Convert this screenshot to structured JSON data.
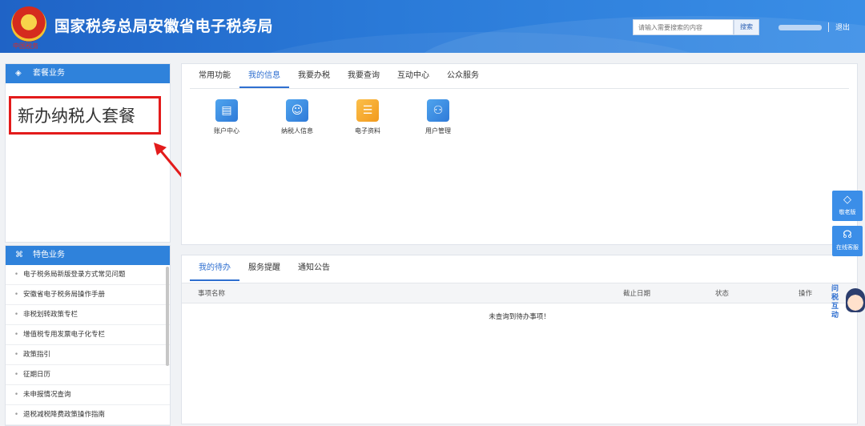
{
  "header": {
    "title": "国家税务总局安徽省电子税务局",
    "emblem_caption": "中国税务",
    "search_placeholder": "请输入需要搜索的内容",
    "search_button": "搜索",
    "logout": "退出"
  },
  "left_panel_package": {
    "title": "套餐业务",
    "highlight_item": "新办纳税人套餐"
  },
  "left_panel_featured": {
    "title": "特色业务",
    "items": [
      "电子税务局新版登录方式常见问题",
      "安徽省电子税务局操作手册",
      "非税划转政策专栏",
      "增值税专用发票电子化专栏",
      "政策指引",
      "征期日历",
      "未申报情况查询",
      "退税减税降费政策操作指南"
    ]
  },
  "main_tabs": [
    "常用功能",
    "我的信息",
    "我要办税",
    "我要查询",
    "互动中心",
    "公众服务"
  ],
  "main_active_tab_index": 1,
  "functions": [
    {
      "label": "账户中心",
      "icon": "account-icon"
    },
    {
      "label": "纳税人信息",
      "icon": "taxpayer-card-icon"
    },
    {
      "label": "电子资料",
      "icon": "documents-icon"
    },
    {
      "label": "用户管理",
      "icon": "users-icon"
    }
  ],
  "todo_panel": {
    "tabs": [
      "我的待办",
      "服务提醒",
      "通知公告"
    ],
    "active_tab_index": 0,
    "columns": [
      "事项名称",
      "截止日期",
      "状态",
      "操作"
    ],
    "empty_message": "未查询到待办事项！"
  },
  "floating": {
    "elder_mode": "敬老版",
    "online_service": "在线客服",
    "assistant_text": "问税互动"
  },
  "colors": {
    "header_blue": "#1f63c6",
    "panel_head_blue": "#2f82db",
    "active_tab": "#2f6fd0",
    "highlight_red": "#e31b1b"
  }
}
